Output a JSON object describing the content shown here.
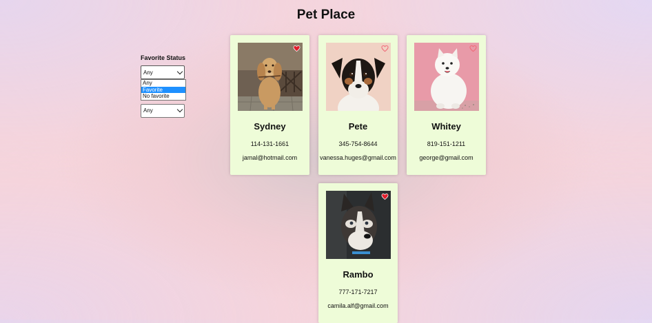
{
  "title": "Pet Place",
  "filter": {
    "label": "Favorite Status",
    "selected": "Any",
    "options": [
      "Any",
      "Favorite",
      "No favorite"
    ],
    "second_selected": "Any"
  },
  "pets": [
    {
      "name": "Sydney",
      "phone": "114-131-1661",
      "email": "jamal@hotmail.com",
      "favorite": true
    },
    {
      "name": "Pete",
      "phone": "345-754-8644",
      "email": "vanessa.huges@gmail.com",
      "favorite": false
    },
    {
      "name": "Whitey",
      "phone": "819-151-1211",
      "email": "george@gmail.com",
      "favorite": false
    },
    {
      "name": "Rambo",
      "phone": "777-171-7217",
      "email": "camila.alf@gmail.com",
      "favorite": true
    }
  ],
  "colors": {
    "heart_filled": "#e01e2c",
    "heart_outline": "#f06a78",
    "card_bg": "#eefcd8",
    "selected_option": "#1e90ff"
  },
  "icons": {
    "heart": "heart-icon",
    "chevron": "chevron-down-icon"
  }
}
